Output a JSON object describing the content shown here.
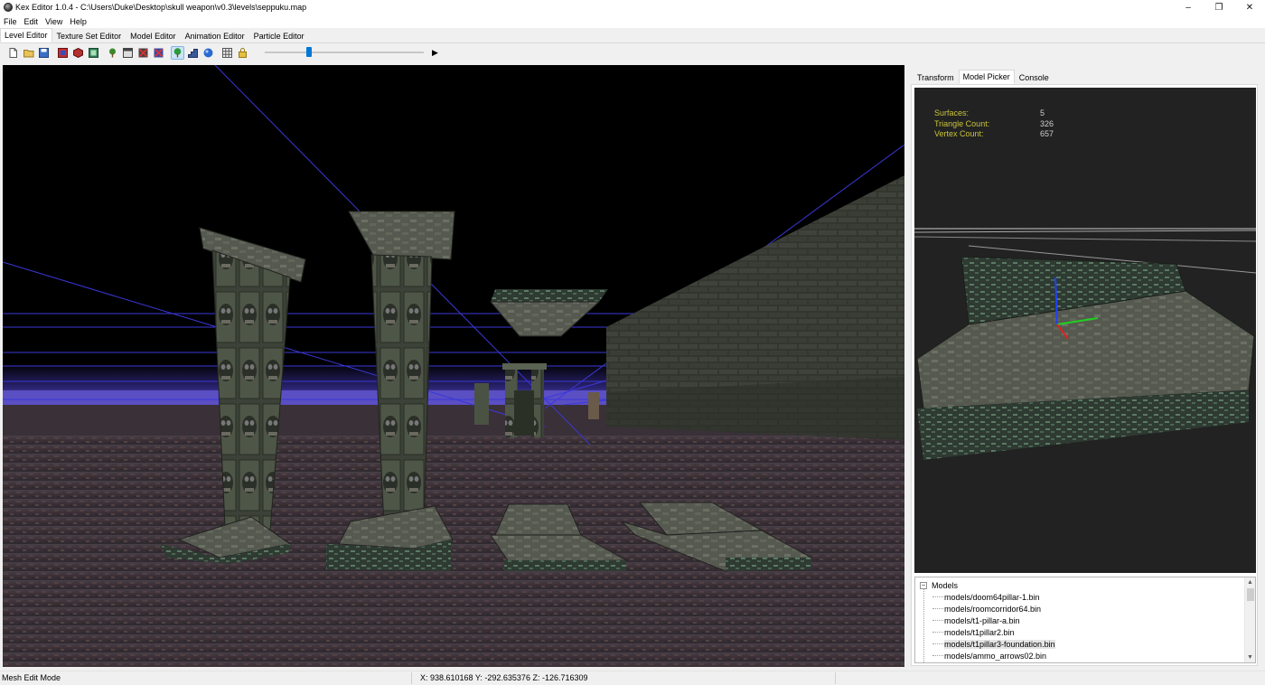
{
  "window": {
    "title": "Kex Editor 1.0.4 - C:\\Users\\Duke\\Desktop\\skull weapon\\v0.3\\levels\\seppuku.map",
    "controls": {
      "minimize": "–",
      "restore": "❐",
      "close": "✕"
    }
  },
  "menu": [
    "File",
    "Edit",
    "View",
    "Help"
  ],
  "editor_tabs": [
    "Level Editor",
    "Texture Set Editor",
    "Model Editor",
    "Animation Editor",
    "Particle Editor"
  ],
  "toolbar": {
    "icons": [
      "new-file-icon",
      "open-folder-icon",
      "save-icon",
      "map-icon",
      "cube-icon",
      "image-icon",
      "tree-icon",
      "window-icon",
      "delete-red-icon",
      "delete-blue-icon",
      "tree-green-icon",
      "stairs-icon",
      "sphere-icon",
      "grid-icon",
      "lock-icon"
    ],
    "slider_value": 0.27,
    "play_label": "▶"
  },
  "right_panel": {
    "tabs": [
      "Transform",
      "Model Picker",
      "Console"
    ],
    "active_tab": "Model Picker",
    "stats": [
      {
        "label": "Surfaces:",
        "value": "5"
      },
      {
        "label": "Triangle Count:",
        "value": "326"
      },
      {
        "label": "Vertex Count:",
        "value": "657"
      }
    ],
    "tree": {
      "root": "Models",
      "items": [
        "models/doom64pillar-1.bin",
        "models/roomcorridor64.bin",
        "models/t1-pillar-a.bin",
        "models/t1pillar2.bin",
        "models/t1pillar3-foundation.bin",
        "models/ammo_arrows02.bin"
      ],
      "selected_index": 4
    }
  },
  "status": {
    "mode": "Mesh Edit Mode",
    "coords": "X: 938.610168 Y: -292.635376 Z: -126.716309"
  },
  "colors": {
    "sky": "#000000",
    "horizon": "#5b4fc4",
    "grid_line": "#3a37d8",
    "floor": "#3a3038",
    "stone": "#4c5446",
    "preview_bg": "#222222",
    "stat_label": "#c9c23b",
    "selection": "#0078d7"
  }
}
